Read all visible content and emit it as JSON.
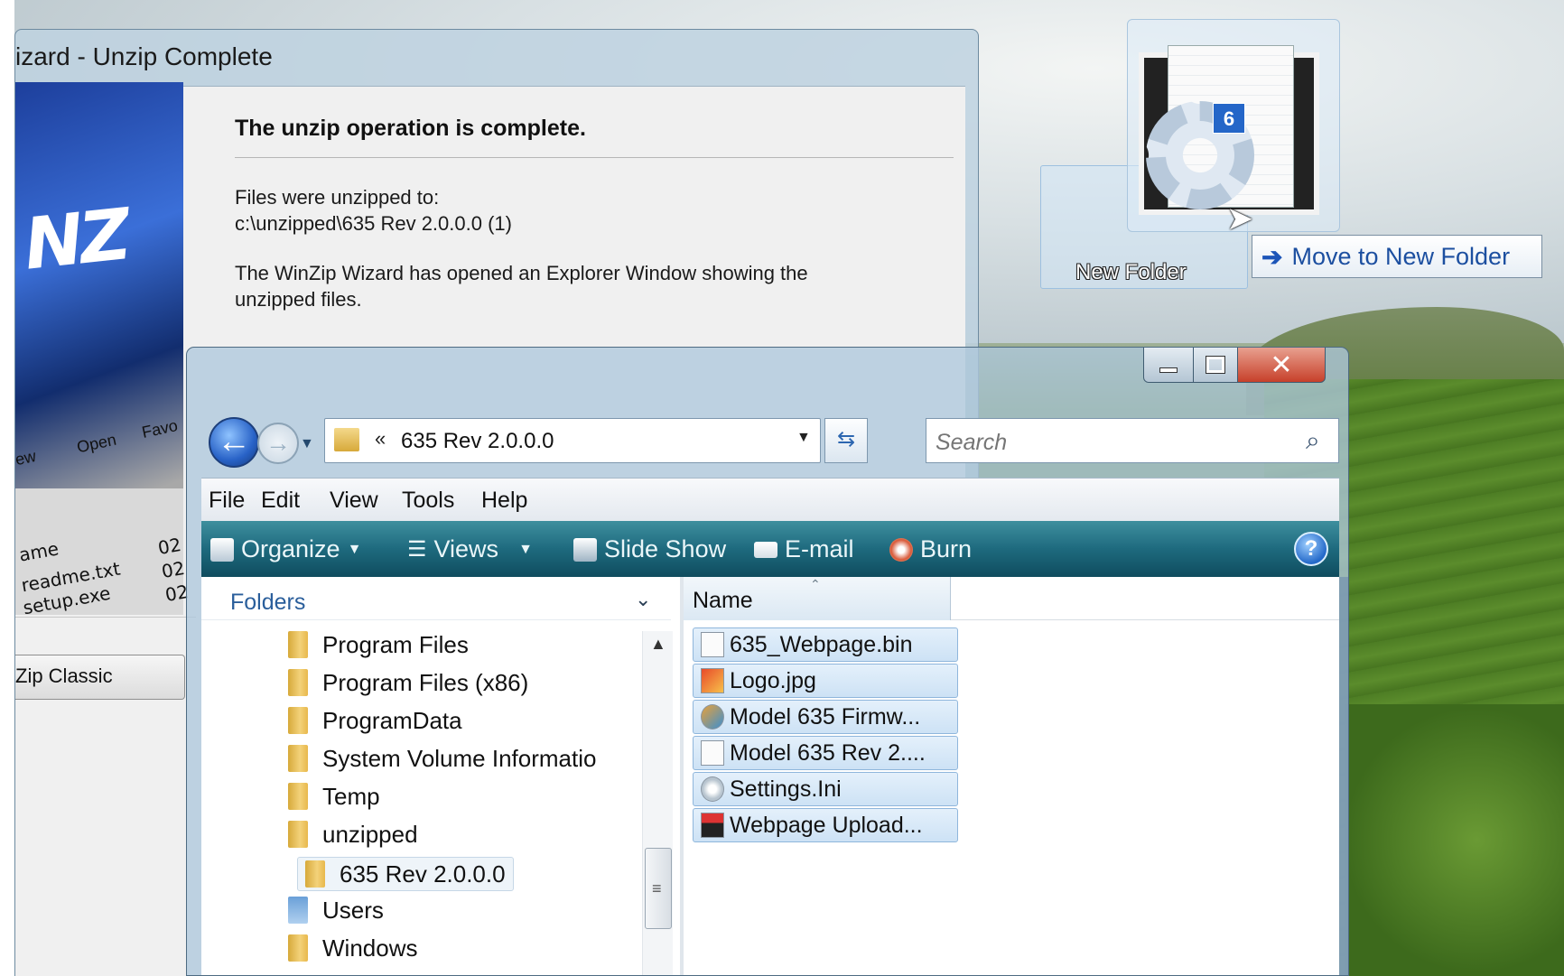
{
  "winzip": {
    "title": "izard - Unzip Complete",
    "heading": "The unzip operation is complete.",
    "line1": "Files were unzipped to:",
    "line2": "c:\\unzipped\\635 Rev 2.0.0.0 (1)",
    "line3": "The WinZip Wizard has opened an Explorer Window showing the",
    "line4": "unzipped files.",
    "logo_text": "NZ",
    "logo_buttons": [
      "ew",
      "Open",
      "Favo"
    ],
    "logo_rows": [
      "ame",
      "readme.txt",
      "setup.exe"
    ],
    "logo_dates": [
      "02",
      "02",
      "02"
    ],
    "classic_button": "Zip Classic"
  },
  "explorer": {
    "address_path": "635 Rev 2.0.0.0",
    "search_placeholder": "Search",
    "menu": [
      "File",
      "Edit",
      "View",
      "Tools",
      "Help"
    ],
    "toolbar": {
      "organize": "Organize",
      "views": "Views",
      "slideshow": "Slide Show",
      "email": "E-mail",
      "burn": "Burn",
      "help": "?"
    },
    "folders_label": "Folders",
    "tree": [
      "Program Files",
      "Program Files (x86)",
      "ProgramData",
      "System Volume Informatio",
      "Temp",
      "unzipped",
      "635 Rev 2.0.0.0",
      "Users",
      "Windows"
    ],
    "column_name": "Name",
    "files": [
      "635_Webpage.bin",
      "Logo.jpg",
      "Model 635 Firmw...",
      "Model 635 Rev 2....",
      "Settings.Ini",
      "Webpage Upload..."
    ]
  },
  "drag": {
    "count_badge": "6",
    "target_label": "New Folder",
    "tooltip": "Move to New Folder"
  },
  "colors": {
    "toolbar": "#1e6a7e",
    "link_blue": "#2a5e9b",
    "selection": "#cde2f5"
  }
}
